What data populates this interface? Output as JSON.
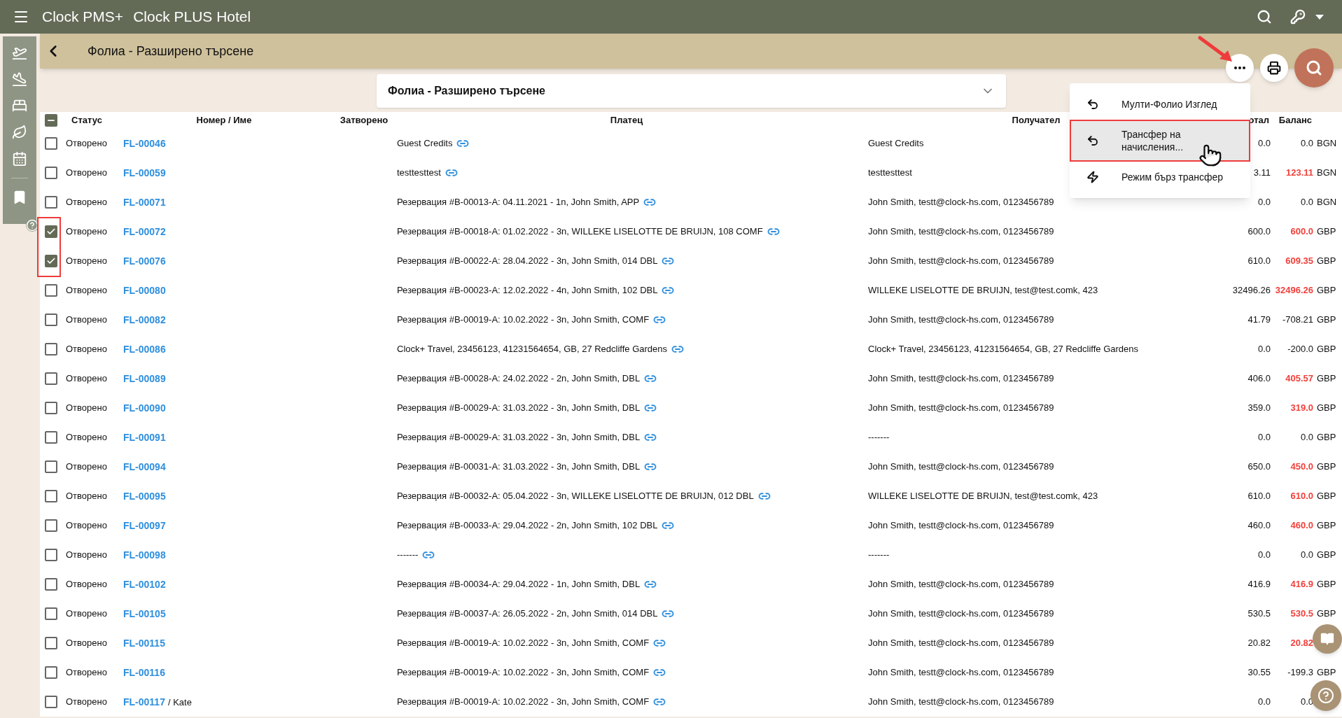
{
  "app_bar": {
    "brand": "Clock PMS+",
    "hotel": "Clock PLUS Hotel"
  },
  "page_header": {
    "title": "Фолиа - Разширено търсене"
  },
  "search_panel": {
    "title": "Фолиа - Разширено търсене",
    "expanded": false
  },
  "actions_menu": {
    "items": [
      {
        "label": "Мулти-Фолио Изглед",
        "kind": "undo",
        "selected": false
      },
      {
        "label": "Трансфер на начисления...",
        "kind": "undo",
        "selected": true
      },
      {
        "label": "Режим бърз трансфер",
        "kind": "bolt",
        "selected": false
      }
    ]
  },
  "table": {
    "select_all": {
      "indeterminate": true
    },
    "columns": [
      "Статус",
      "Номер / Име",
      "Затворено",
      "Платец",
      "Получател",
      "отал",
      "Баланс"
    ],
    "rows": [
      {
        "checked": false,
        "status": "Отворено",
        "number": "FL-00046",
        "payer": "Guest Credits",
        "recipient": "Guest Credits",
        "total": "0.0",
        "balance": "0.0",
        "outstanding": false,
        "currency": "BGN"
      },
      {
        "checked": false,
        "status": "Отворено",
        "number": "FL-00059",
        "payer": "testtesttest",
        "recipient": "testtesttest",
        "total": "3.11",
        "balance": "123.11",
        "outstanding": true,
        "currency": "BGN"
      },
      {
        "checked": false,
        "status": "Отворено",
        "number": "FL-00071",
        "payer": "Резервация #B-00013-A: 04.11.2021 - 1n, John Smith, APP",
        "recipient": "John Smith, testt@clock-hs.com, 0123456789",
        "total": "0.0",
        "balance": "0.0",
        "outstanding": false,
        "currency": "BGN"
      },
      {
        "checked": true,
        "status": "Отворено",
        "number": "FL-00072",
        "payer": "Резервация #B-00018-A: 01.02.2022 - 3n, WILLEKE LISELOTTE DE BRUIJN, 108 COMF",
        "recipient": "John Smith, testt@clock-hs.com, 0123456789",
        "total": "600.0",
        "balance": "600.0",
        "outstanding": true,
        "currency": "GBP"
      },
      {
        "checked": true,
        "status": "Отворено",
        "number": "FL-00076",
        "payer": "Резервация #B-00022-A: 28.04.2022 - 3n, John Smith, 014 DBL",
        "recipient": "John Smith, testt@clock-hs.com, 0123456789",
        "total": "610.0",
        "balance": "609.35",
        "outstanding": true,
        "currency": "GBP"
      },
      {
        "checked": false,
        "status": "Отворено",
        "number": "FL-00080",
        "payer": "Резервация #B-00023-A: 12.02.2022 - 4n, John Smith, 102 DBL",
        "recipient": "WILLEKE LISELOTTE DE BRUIJN, test@test.comk, 423",
        "total": "32496.26",
        "balance": "32496.26",
        "outstanding": true,
        "currency": "GBP"
      },
      {
        "checked": false,
        "status": "Отворено",
        "number": "FL-00082",
        "payer": "Резервация #B-00019-A: 10.02.2022 - 3n, John Smith, COMF",
        "recipient": "John Smith, testt@clock-hs.com, 0123456789",
        "total": "41.79",
        "balance": "-708.21",
        "outstanding": false,
        "currency": "GBP"
      },
      {
        "checked": false,
        "status": "Отворено",
        "number": "FL-00086",
        "payer": "Clock+ Travel, 23456123, 41231564654, GB, 27 Redcliffe Gardens",
        "recipient": "Clock+ Travel, 23456123, 41231564654, GB, 27 Redcliffe Gardens",
        "total": "0.0",
        "balance": "-200.0",
        "outstanding": false,
        "currency": "GBP"
      },
      {
        "checked": false,
        "status": "Отворено",
        "number": "FL-00089",
        "payer": "Резервация #B-00028-A: 24.02.2022 - 2n, John Smith, DBL",
        "recipient": "John Smith, testt@clock-hs.com, 0123456789",
        "total": "406.0",
        "balance": "405.57",
        "outstanding": true,
        "currency": "GBP"
      },
      {
        "checked": false,
        "status": "Отворено",
        "number": "FL-00090",
        "payer": "Резервация #B-00029-A: 31.03.2022 - 3n, John Smith, DBL",
        "recipient": "John Smith, testt@clock-hs.com, 0123456789",
        "total": "359.0",
        "balance": "319.0",
        "outstanding": true,
        "currency": "GBP"
      },
      {
        "checked": false,
        "status": "Отворено",
        "number": "FL-00091",
        "payer": "Резервация #B-00029-A: 31.03.2022 - 3n, John Smith, DBL",
        "recipient": "-------",
        "total": "0.0",
        "balance": "0.0",
        "outstanding": false,
        "currency": "GBP"
      },
      {
        "checked": false,
        "status": "Отворено",
        "number": "FL-00094",
        "payer": "Резервация #B-00031-A: 31.03.2022 - 3n, John Smith, DBL",
        "recipient": "John Smith, testt@clock-hs.com, 0123456789",
        "total": "650.0",
        "balance": "450.0",
        "outstanding": true,
        "currency": "GBP"
      },
      {
        "checked": false,
        "status": "Отворено",
        "number": "FL-00095",
        "payer": "Резервация #B-00032-A: 05.04.2022 - 3n, WILLEKE LISELOTTE DE BRUIJN, 012 DBL",
        "recipient": "WILLEKE LISELOTTE DE BRUIJN, test@test.comk, 423",
        "total": "610.0",
        "balance": "610.0",
        "outstanding": true,
        "currency": "GBP"
      },
      {
        "checked": false,
        "status": "Отворено",
        "number": "FL-00097",
        "payer": "Резервация #B-00033-A: 29.04.2022 - 2n, John Smith, 102 DBL",
        "recipient": "John Smith, testt@clock-hs.com, 0123456789",
        "total": "460.0",
        "balance": "460.0",
        "outstanding": true,
        "currency": "GBP"
      },
      {
        "checked": false,
        "status": "Отворено",
        "number": "FL-00098",
        "payer": "-------",
        "recipient": "-------",
        "total": "0.0",
        "balance": "0.0",
        "outstanding": false,
        "currency": "GBP"
      },
      {
        "checked": false,
        "status": "Отворено",
        "number": "FL-00102",
        "payer": "Резервация #B-00034-A: 29.04.2022 - 1n, John Smith, DBL",
        "recipient": "John Smith, testt@clock-hs.com, 0123456789",
        "total": "416.9",
        "balance": "416.9",
        "outstanding": true,
        "currency": "GBP"
      },
      {
        "checked": false,
        "status": "Отворено",
        "number": "FL-00105",
        "payer": "Резервация #B-00037-A: 26.05.2022 - 2n, John Smith, 014 DBL",
        "recipient": "John Smith, testt@clock-hs.com, 0123456789",
        "total": "530.5",
        "balance": "530.5",
        "outstanding": true,
        "currency": "GBP"
      },
      {
        "checked": false,
        "status": "Отворено",
        "number": "FL-00115",
        "payer": "Резервация #B-00019-A: 10.02.2022 - 3n, John Smith, COMF",
        "recipient": "John Smith, testt@clock-hs.com, 0123456789",
        "total": "20.82",
        "balance": "20.82",
        "outstanding": true
      },
      {
        "checked": false,
        "status": "Отворено",
        "number": "FL-00116",
        "payer": "Резервация #B-00019-A: 10.02.2022 - 3n, John Smith, COMF",
        "recipient": "John Smith, testt@clock-hs.com, 0123456789",
        "total": "30.55",
        "balance": "-199.3",
        "outstanding": false,
        "currency": "GBP"
      },
      {
        "checked": false,
        "status": "Отворено",
        "number": "FL-00117",
        "name": "/ Kate",
        "payer": "Резервация #B-00019-A: 10.02.2022 - 3n, John Smith, COMF",
        "recipient": "John Smith, testt@clock-hs.com, 0123456789",
        "total": "0.0",
        "balance": "0.0",
        "outstanding": false
      }
    ]
  }
}
